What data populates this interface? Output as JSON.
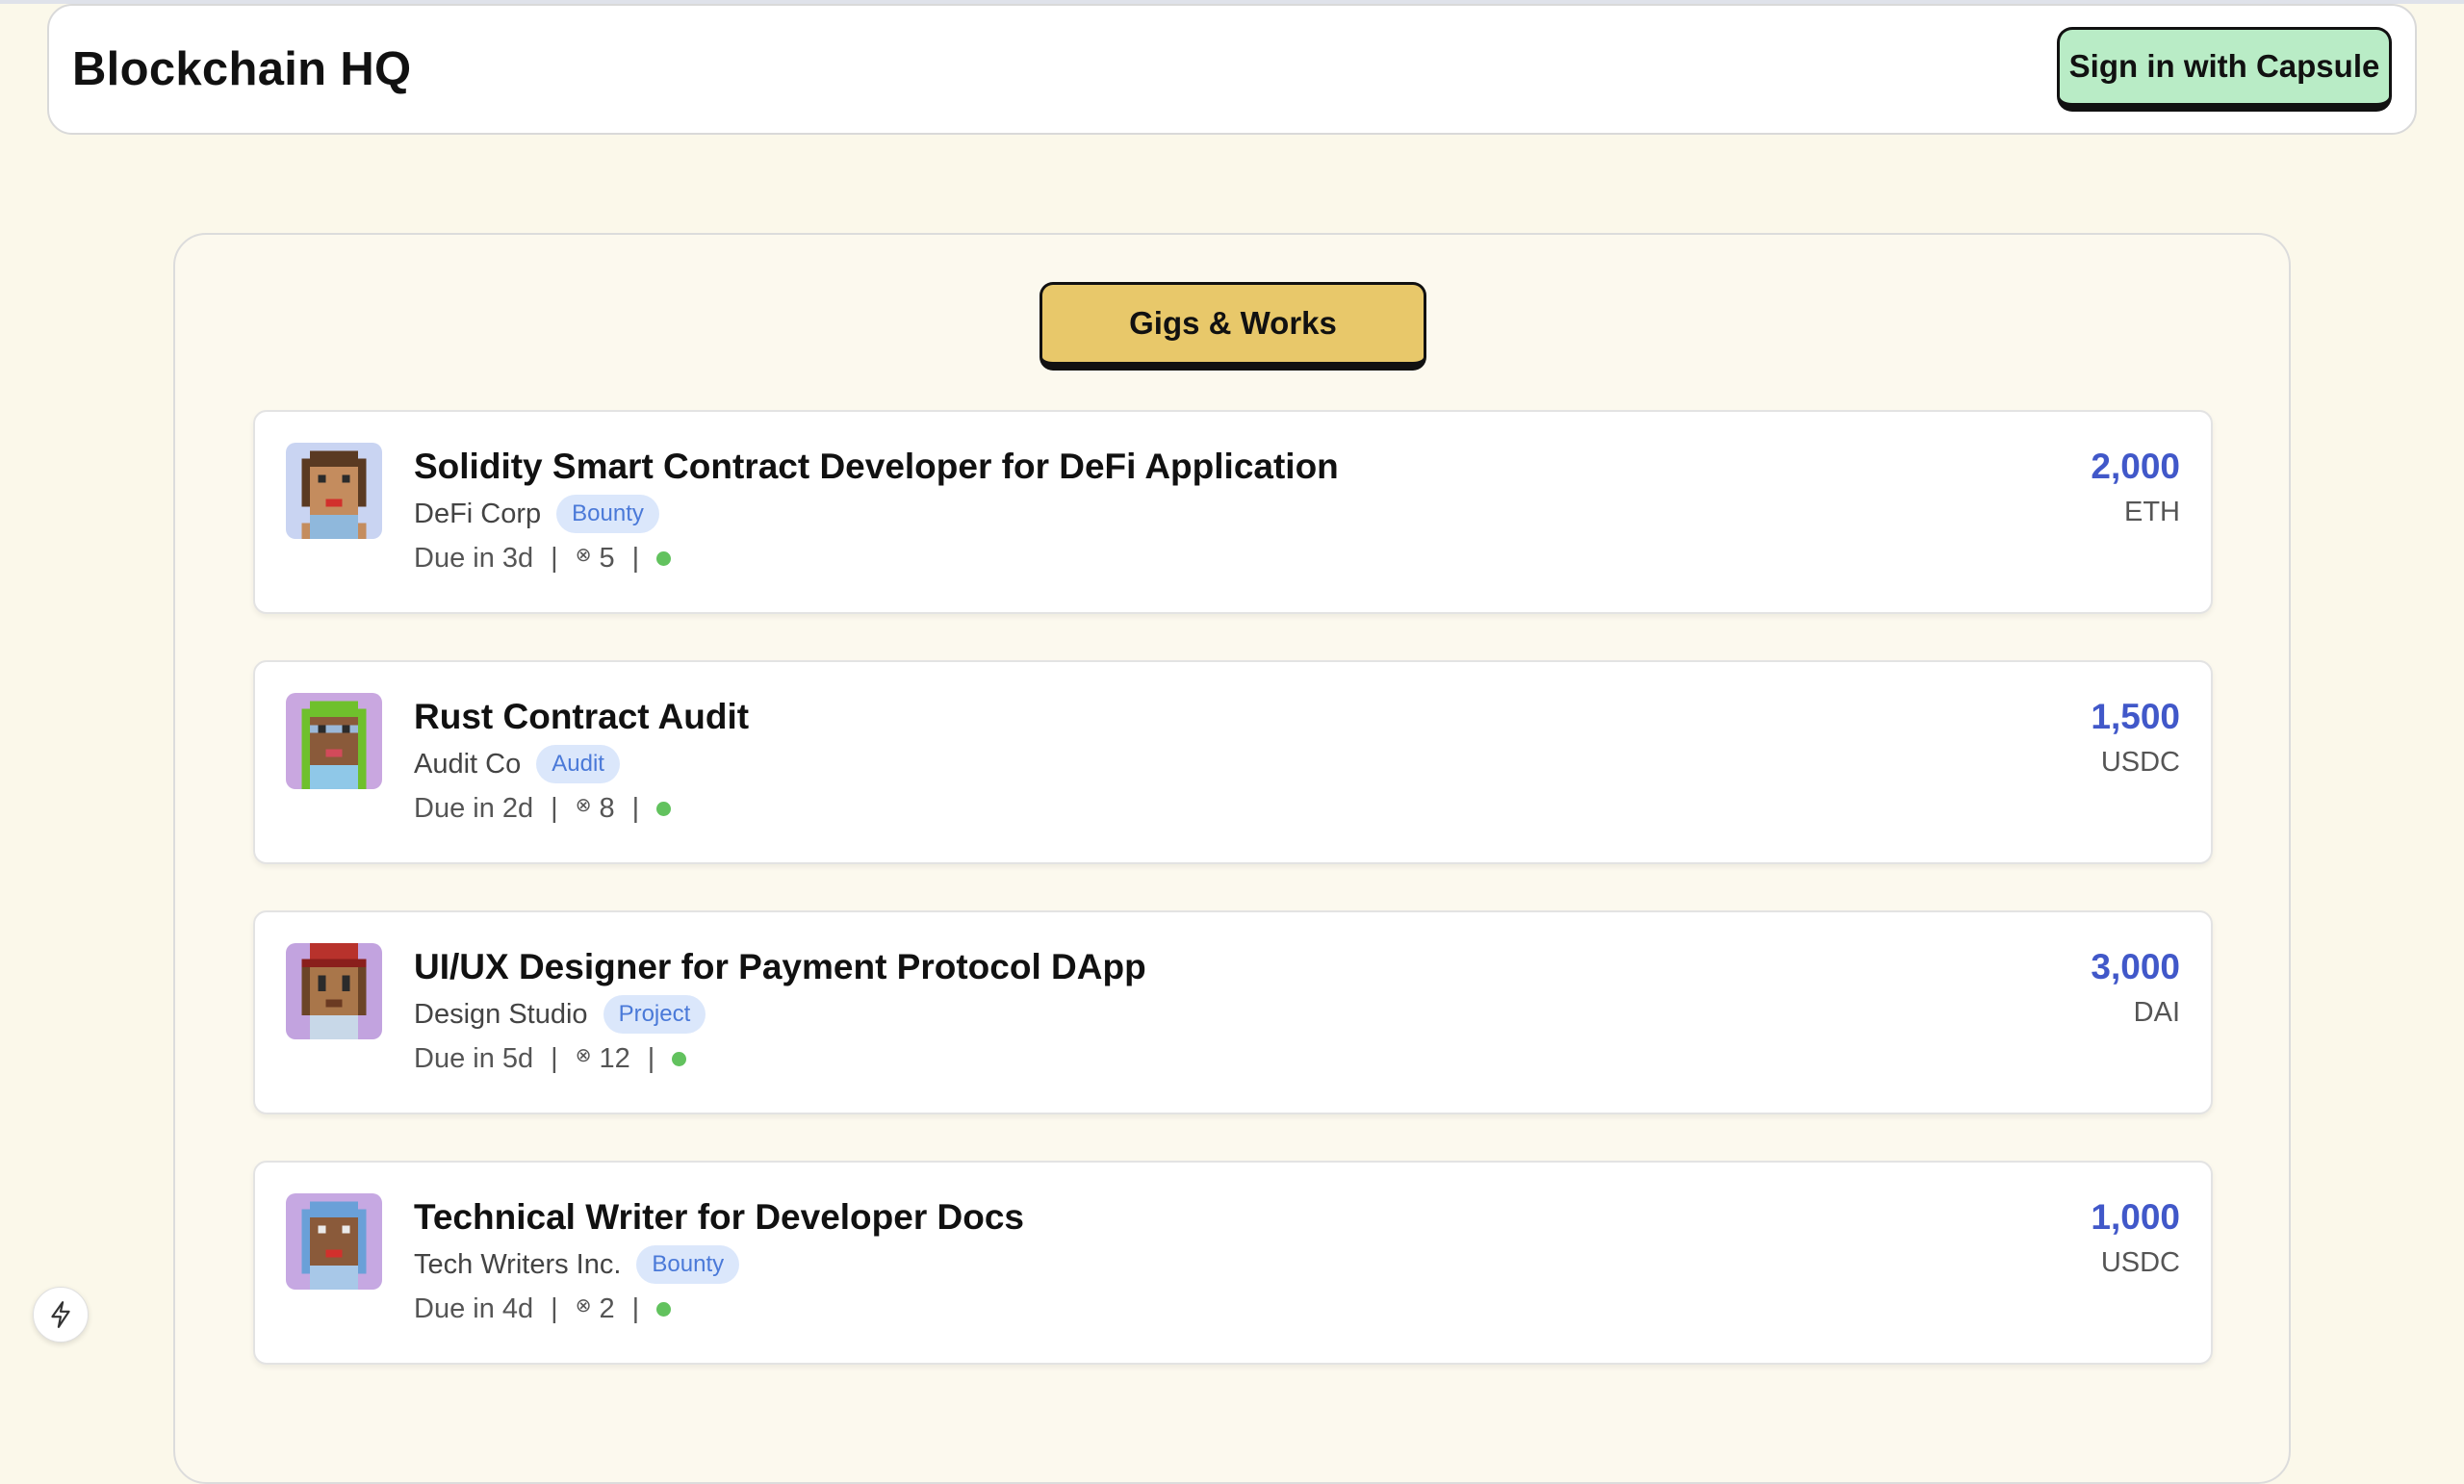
{
  "header": {
    "title": "Blockchain HQ",
    "signin_label": "Sign in with Capsule"
  },
  "main": {
    "section_label": "Gigs & Works",
    "gigs": [
      {
        "title": "Solidity Smart Contract Developer for DeFi Application",
        "company": "DeFi Corp",
        "tag": "Bounty",
        "due": "Due in 3d",
        "applicants": "5",
        "reward_amount": "2,000",
        "reward_currency": "ETH",
        "avatar_icon": "pixel-avatar-icon"
      },
      {
        "title": "Rust Contract Audit",
        "company": "Audit Co",
        "tag": "Audit",
        "due": "Due in 2d",
        "applicants": "8",
        "reward_amount": "1,500",
        "reward_currency": "USDC",
        "avatar_icon": "pixel-avatar-icon"
      },
      {
        "title": "UI/UX Designer for Payment Protocol DApp",
        "company": "Design Studio",
        "tag": "Project",
        "due": "Due in 5d",
        "applicants": "12",
        "reward_amount": "3,000",
        "reward_currency": "DAI",
        "avatar_icon": "pixel-avatar-icon"
      },
      {
        "title": "Technical Writer for Developer Docs",
        "company": "Tech Writers Inc.",
        "tag": "Bounty",
        "due": "Due in 4d",
        "applicants": "2",
        "reward_amount": "1,000",
        "reward_currency": "USDC",
        "avatar_icon": "pixel-avatar-icon"
      }
    ]
  },
  "separator": "|",
  "applicants_icon": "⊗",
  "colors": {
    "background": "#fbf8ea",
    "signin_button": "#b9ecc6",
    "section_button": "#e8c86a",
    "tag_bg": "#dbe7fb",
    "tag_text": "#4a79d8",
    "reward": "#4158c9",
    "status_active": "#62c25e"
  },
  "floating_button_icon": "lightning-bolt-icon"
}
